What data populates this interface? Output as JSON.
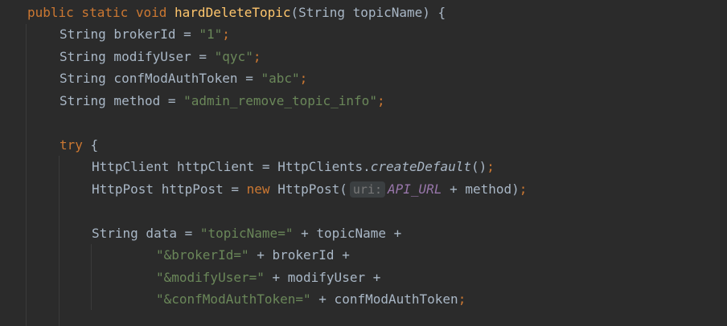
{
  "code": {
    "l1": {
      "mod": "public static void ",
      "name": "hardDeleteTopic",
      "params": "(String topicName) {"
    },
    "l2": {
      "pre": "String brokerId = ",
      "str": "\"1\"",
      "semi": ";"
    },
    "l3": {
      "pre": "String modifyUser = ",
      "str": "\"qyc\"",
      "semi": ";"
    },
    "l4": {
      "pre": "String confModAuthToken = ",
      "str": "\"abc\"",
      "semi": ";"
    },
    "l5": {
      "pre": "String method = ",
      "str": "\"admin_remove_topic_info\"",
      "semi": ";"
    },
    "l6": {
      "kw": "try",
      "rest": " {"
    },
    "l7": {
      "pre": "HttpClient httpClient = HttpClients.",
      "call": "createDefault",
      "post": "()",
      "semi": ";"
    },
    "l8": {
      "pre": "HttpPost httpPost = ",
      "kw": "new",
      "mid": " HttpPost(",
      "hint": "uri:",
      "const": "API_URL",
      "post": " + method)",
      "semi": ";"
    },
    "l9": {
      "pre": "String data = ",
      "str": "\"topicName=\"",
      "post": " + topicName +"
    },
    "l10": {
      "str": "\"&brokerId=\"",
      "post": " + brokerId +"
    },
    "l11": {
      "str": "\"&modifyUser=\"",
      "post": " + modifyUser +"
    },
    "l12": {
      "str": "\"&confModAuthToken=\"",
      "post": " + confModAuthToken",
      "semi": ";"
    }
  },
  "colors": {
    "background": "#2b2b2b",
    "keyword": "#cc7832",
    "function": "#ffc66d",
    "string": "#6a8759",
    "constant": "#9876aa",
    "text": "#a9b7c6"
  }
}
